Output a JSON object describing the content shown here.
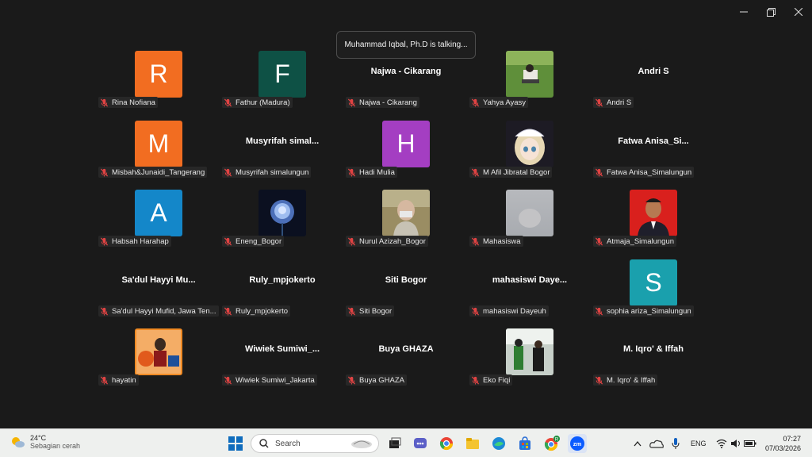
{
  "window": {
    "min_icon": "minimize-icon",
    "max_icon": "restore-icon",
    "close_icon": "close-icon"
  },
  "talking_banner": "Muhammad Iqbal, Ph.D is talking...",
  "participants": [
    {
      "kind": "initial",
      "initial": "R",
      "color": "#f26d21",
      "tag": "Rina Nofiana"
    },
    {
      "kind": "initial",
      "initial": "F",
      "color": "#0e5145",
      "tag": "Fathur (Madura)"
    },
    {
      "kind": "name",
      "display": "Najwa - Cikarang",
      "tag": "Najwa - Cikarang"
    },
    {
      "kind": "photo",
      "photo": "field",
      "tag": "Yahya Ayasy"
    },
    {
      "kind": "name",
      "display": "Andri S",
      "tag": "Andri S"
    },
    {
      "kind": "initial",
      "initial": "M",
      "color": "#f26d21",
      "tag": "Misbah&Junaidi_Tangerang"
    },
    {
      "kind": "name",
      "display": "Musyrifah  simal...",
      "tag": "Musyrifah simalungun"
    },
    {
      "kind": "initial",
      "initial": "H",
      "color": "#a43ec2",
      "tag": "Hadi Mulia"
    },
    {
      "kind": "photo",
      "photo": "anime",
      "tag": "M Afil Jibratal Bogor"
    },
    {
      "kind": "name",
      "display": "Fatwa  Anisa_Si...",
      "tag": "Fatwa Anisa_Simalungun"
    },
    {
      "kind": "initial",
      "initial": "A",
      "color": "#1487c9",
      "tag": "Habsah Harahap"
    },
    {
      "kind": "photo",
      "photo": "rose",
      "tag": "Eneng_Bogor"
    },
    {
      "kind": "photo",
      "photo": "woman",
      "tag": "Nurul Azizah_Bogor"
    },
    {
      "kind": "photo",
      "photo": "blur",
      "tag": "Mahasiswa"
    },
    {
      "kind": "photo",
      "photo": "portrait",
      "tag": "Atmaja_Simalungun"
    },
    {
      "kind": "name",
      "display": "Sa'dul  Hayyi  Mu...",
      "tag": "Sa'dul Hayyi Mufid, Jawa Ten..."
    },
    {
      "kind": "name",
      "display": "Ruly_mpjokerto",
      "tag": "Ruly_mpjokerto"
    },
    {
      "kind": "name",
      "display": "Siti Bogor",
      "tag": "Siti Bogor"
    },
    {
      "kind": "name",
      "display": "mahasiswi  Daye...",
      "tag": "mahasiswi Dayeuh"
    },
    {
      "kind": "initial",
      "initial": "S",
      "color": "#1aa0ad",
      "tag": "sophia ariza_Simalungun"
    },
    {
      "kind": "photo",
      "photo": "poster",
      "tag": "hayatin"
    },
    {
      "kind": "name",
      "display": "Wiwiek  Sumiwi_...",
      "tag": "Wiwiek Sumiwi_Jakarta"
    },
    {
      "kind": "name",
      "display": "Buya GHAZA",
      "tag": "Buya GHAZA"
    },
    {
      "kind": "photo",
      "photo": "group",
      "tag": "Eko Fiqi"
    },
    {
      "kind": "name",
      "display": "M. Iqro' & Iffah",
      "tag": "M. Iqro' & Iffah"
    }
  ],
  "taskbar": {
    "weather_temp": "24°C",
    "weather_cond": "Sebagian cerah",
    "search_placeholder": "Search",
    "lang": "ENG",
    "time": "07:27",
    "date": "07/03/2026",
    "chrome_badge": "R",
    "zoom_label": "zm",
    "accent": "#0a59d6"
  }
}
